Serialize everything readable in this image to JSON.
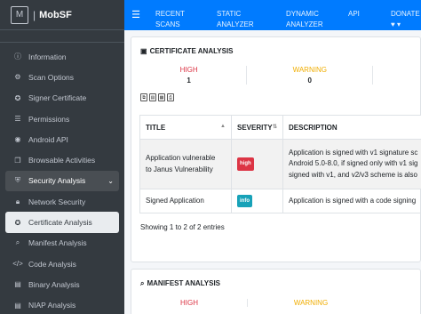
{
  "brand": {
    "name": "MobSF"
  },
  "sidebar": {
    "items": [
      {
        "label": "Information",
        "icon": "info-circle-icon"
      },
      {
        "label": "Scan Options",
        "icon": "cog-icon"
      },
      {
        "label": "Signer Certificate",
        "icon": "certificate-icon"
      },
      {
        "label": "Permissions",
        "icon": "list-icon"
      },
      {
        "label": "Android API",
        "icon": "android-icon"
      },
      {
        "label": "Browsable Activities",
        "icon": "clone-icon"
      },
      {
        "label": "Security Analysis",
        "icon": "shield-icon"
      }
    ],
    "sub_items": [
      {
        "label": "Network Security",
        "icon": "lock-icon"
      },
      {
        "label": "Certificate Analysis",
        "icon": "certificate-icon"
      },
      {
        "label": "Manifest Analysis",
        "icon": "search-icon"
      },
      {
        "label": "Code Analysis",
        "icon": "code-icon"
      },
      {
        "label": "Binary Analysis",
        "icon": "file-icon"
      },
      {
        "label": "NIAP Analysis",
        "icon": "file-icon"
      }
    ]
  },
  "topnav": {
    "items": [
      {
        "line1": "RECENT",
        "line2": "SCANS"
      },
      {
        "line1": "STATIC",
        "line2": "ANALYZER"
      },
      {
        "line1": "DYNAMIC",
        "line2": "ANALYZER"
      },
      {
        "line1": "API",
        "line2": ""
      },
      {
        "line1": "DONATE",
        "line2": "♥ ▾"
      }
    ]
  },
  "cert_card": {
    "title": "CERTIFICATE ANALYSIS",
    "stats": [
      {
        "label": "HIGH",
        "value": "1",
        "color": "#dc3545"
      },
      {
        "label": "WARNING",
        "value": "0",
        "color": "#f0ad00"
      }
    ],
    "columns": [
      "TITLE",
      "SEVERITY",
      "DESCRIPTION"
    ],
    "rows": [
      {
        "title_l1": "Application vulnerable",
        "title_l2": "to Janus Vulnerability",
        "severity": "high",
        "desc_l1": "Application is signed with v1 signature sc",
        "desc_l2": "Android 5.0-8.0, if signed only with v1 sig",
        "desc_l3": "signed with v1, and v2/v3 scheme is also"
      },
      {
        "title_l1": "Signed Application",
        "severity": "info",
        "desc_l1": "Application is signed with a code signing"
      }
    ],
    "entries": "Showing 1 to 2 of 2 entries"
  },
  "manifest_card": {
    "title": "MANIFEST ANALYSIS",
    "stats": [
      {
        "label": "HIGH"
      },
      {
        "label": "WARNING"
      }
    ]
  }
}
